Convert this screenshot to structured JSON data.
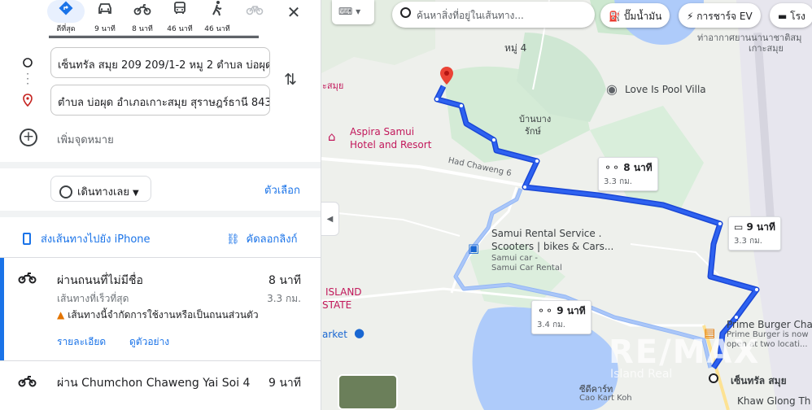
{
  "travel_modes": [
    {
      "name": "best",
      "label": "ดีที่สุด",
      "icon": "directions-icon",
      "active": true
    },
    {
      "name": "car",
      "label": "9 นาที",
      "icon": "car-icon"
    },
    {
      "name": "motorcycle",
      "label": "8 นาที",
      "icon": "motorcycle-icon"
    },
    {
      "name": "transit",
      "label": "46 นาที",
      "icon": "bus-icon"
    },
    {
      "name": "walk",
      "label": "46 นาที",
      "icon": "walk-icon"
    },
    {
      "name": "bike",
      "label": "",
      "icon": "bicycle-icon",
      "disabled": true
    }
  ],
  "waypoints": {
    "origin": "เซ็นทรัล สมุย 209 209/1-2 หมู 2 ตำบล บ่อผุด",
    "destination": "ตำบล บ่อผุด อำเภอเกาะสมุย สุราษฎร์ธานี 843",
    "add_destination": "เพิ่มจุดหมาย"
  },
  "leave_now": "เดินทางเลย",
  "options": "ตัวเลือก",
  "send_to_phone": "ส่งเส้นทางไปยัง iPhone",
  "copy_link": "คัดลอกลิงก์",
  "routes": [
    {
      "title": "ผ่านถนนที่ไม่มีชื่อ",
      "time": "8 นาที",
      "subtitle": "เส้นทางที่เร็วที่สุด",
      "distance": "3.3 กม.",
      "warning": "เส้นทางนี้จำกัดการใช้งานหรือเป็นถนนส่วนตัว",
      "details": "รายละเอียด",
      "preview": "ดูตัวอย่าง"
    },
    {
      "title": "ผ่าน Chumchon Chaweng Yai Soi 4",
      "time": "9 นาที"
    }
  ],
  "map": {
    "search_placeholder": "ค้นหาสิ่งที่อยู่ในเส้นทาง...",
    "chips": [
      "ปั๊มน้ำมัน",
      "การชาร์จ EV",
      "โรง"
    ],
    "labels": {
      "moo4": "หมู่ 4",
      "airport": "ท่าอากาศยานนานาชาติสมุ",
      "airport2": "เกาะสมุย",
      "samui_left": "ะสมุย",
      "love_is_pool": "Love Is Pool Villa",
      "ban_bang": "บ้านบาง",
      "ban_bang2": "รักษ์",
      "aspira1": "Aspira Samui",
      "aspira2": "Hotel and Resort",
      "had_chaweng": "Had Chaweng 6",
      "samui_rental1": "Samui Rental Service .",
      "samui_rental2": "Scooters | bikes & Cars...",
      "samui_rental3": "Samui car -",
      "samui_rental4": "Samui Car Rental",
      "island1": "ISLAND",
      "island2": "STATE",
      "market": "arket",
      "prime1": "Prime Burger Cha",
      "prime2": "Prime Burger is now",
      "prime3": "open at two locati...",
      "central": "เซ็นทรัล สมุย",
      "khaw_glong": "Khaw Glong Th",
      "cdc": "ซีดีคาร์ท",
      "cdc2": "Cao Kart Koh"
    },
    "duration_boxes": [
      {
        "time": "8 นาที",
        "distance": "3.3 กม.",
        "icon": "motorcycle-icon"
      },
      {
        "time": "9 นาที",
        "distance": "3.3 กม.",
        "icon": "car-icon"
      },
      {
        "time": "9 นาที",
        "distance": "3.4 กม.",
        "icon": "motorcycle-icon"
      }
    ],
    "watermark": "RE/MAX",
    "watermark_sub": "Island Real"
  }
}
